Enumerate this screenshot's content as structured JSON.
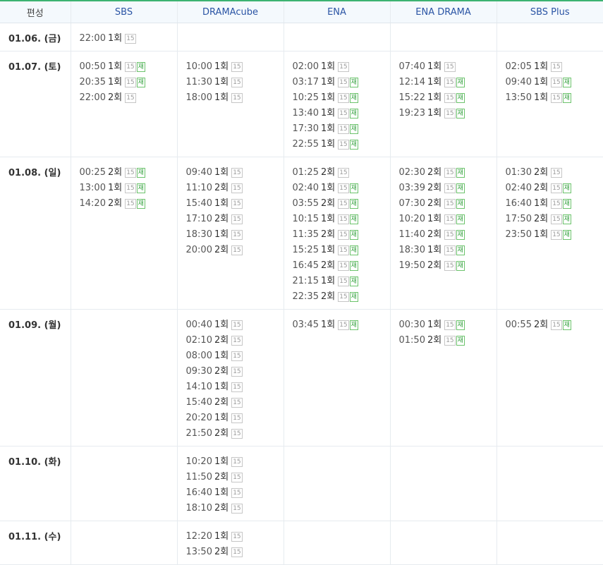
{
  "header": {
    "label": "편성",
    "channels": [
      "SBS",
      "DRAMAcube",
      "ENA",
      "ENA DRAMA",
      "SBS Plus"
    ]
  },
  "rows": [
    {
      "date": "01.06. (금)",
      "height": 36,
      "cells": [
        [
          {
            "time": "22:00",
            "ep": "1회",
            "rating": "15",
            "re": ""
          }
        ],
        [],
        [],
        [],
        []
      ]
    },
    {
      "date": "01.07. (토)",
      "height": 146,
      "cells": [
        [
          {
            "time": "00:50",
            "ep": "1회",
            "rating": "15",
            "re": "재"
          },
          {
            "time": "20:35",
            "ep": "1회",
            "rating": "15",
            "re": "재"
          },
          {
            "time": "22:00",
            "ep": "2회",
            "rating": "15",
            "re": ""
          }
        ],
        [
          {
            "time": "10:00",
            "ep": "1회",
            "rating": "15",
            "re": ""
          },
          {
            "time": "11:30",
            "ep": "1회",
            "rating": "15",
            "re": ""
          },
          {
            "time": "18:00",
            "ep": "1회",
            "rating": "15",
            "re": ""
          }
        ],
        [
          {
            "time": "02:00",
            "ep": "1회",
            "rating": "15",
            "re": ""
          },
          {
            "time": "03:17",
            "ep": "1회",
            "rating": "15",
            "re": "재"
          },
          {
            "time": "10:25",
            "ep": "1회",
            "rating": "15",
            "re": "재"
          },
          {
            "time": "13:40",
            "ep": "1회",
            "rating": "15",
            "re": "재"
          },
          {
            "time": "17:30",
            "ep": "1회",
            "rating": "15",
            "re": "재"
          },
          {
            "time": "22:55",
            "ep": "1회",
            "rating": "15",
            "re": "재"
          }
        ],
        [
          {
            "time": "07:40",
            "ep": "1회",
            "rating": "15",
            "re": ""
          },
          {
            "time": "12:14",
            "ep": "1회",
            "rating": "15",
            "re": "재"
          },
          {
            "time": "15:22",
            "ep": "1회",
            "rating": "15",
            "re": "재"
          },
          {
            "time": "19:23",
            "ep": "1회",
            "rating": "15",
            "re": "재"
          }
        ],
        [
          {
            "time": "02:05",
            "ep": "1회",
            "rating": "15",
            "re": ""
          },
          {
            "time": "09:40",
            "ep": "1회",
            "rating": "15",
            "re": "재"
          },
          {
            "time": "13:50",
            "ep": "1회",
            "rating": "15",
            "re": "재"
          }
        ]
      ]
    },
    {
      "date": "01.08. (일)",
      "height": 212,
      "cells": [
        [
          {
            "time": "00:25",
            "ep": "2회",
            "rating": "15",
            "re": "재"
          },
          {
            "time": "13:00",
            "ep": "1회",
            "rating": "15",
            "re": "재"
          },
          {
            "time": "14:20",
            "ep": "2회",
            "rating": "15",
            "re": "재"
          }
        ],
        [
          {
            "time": "09:40",
            "ep": "1회",
            "rating": "15",
            "re": ""
          },
          {
            "time": "11:10",
            "ep": "2회",
            "rating": "15",
            "re": ""
          },
          {
            "time": "15:40",
            "ep": "1회",
            "rating": "15",
            "re": ""
          },
          {
            "time": "17:10",
            "ep": "2회",
            "rating": "15",
            "re": ""
          },
          {
            "time": "18:30",
            "ep": "1회",
            "rating": "15",
            "re": ""
          },
          {
            "time": "20:00",
            "ep": "2회",
            "rating": "15",
            "re": ""
          }
        ],
        [
          {
            "time": "01:25",
            "ep": "2회",
            "rating": "15",
            "re": ""
          },
          {
            "time": "02:40",
            "ep": "1회",
            "rating": "15",
            "re": "재"
          },
          {
            "time": "03:55",
            "ep": "2회",
            "rating": "15",
            "re": "재"
          },
          {
            "time": "10:15",
            "ep": "1회",
            "rating": "15",
            "re": "재"
          },
          {
            "time": "11:35",
            "ep": "2회",
            "rating": "15",
            "re": "재"
          },
          {
            "time": "15:25",
            "ep": "1회",
            "rating": "15",
            "re": "재"
          },
          {
            "time": "16:45",
            "ep": "2회",
            "rating": "15",
            "re": "재"
          },
          {
            "time": "21:15",
            "ep": "1회",
            "rating": "15",
            "re": "재"
          },
          {
            "time": "22:35",
            "ep": "2회",
            "rating": "15",
            "re": "재"
          }
        ],
        [
          {
            "time": "02:30",
            "ep": "2회",
            "rating": "15",
            "re": "재"
          },
          {
            "time": "03:39",
            "ep": "2회",
            "rating": "15",
            "re": "재"
          },
          {
            "time": "07:30",
            "ep": "2회",
            "rating": "15",
            "re": "재"
          },
          {
            "time": "10:20",
            "ep": "1회",
            "rating": "15",
            "re": "재"
          },
          {
            "time": "11:40",
            "ep": "2회",
            "rating": "15",
            "re": "재"
          },
          {
            "time": "18:30",
            "ep": "1회",
            "rating": "15",
            "re": "재"
          },
          {
            "time": "19:50",
            "ep": "2회",
            "rating": "15",
            "re": "재"
          }
        ],
        [
          {
            "time": "01:30",
            "ep": "2회",
            "rating": "15",
            "re": ""
          },
          {
            "time": "02:40",
            "ep": "2회",
            "rating": "15",
            "re": "재"
          },
          {
            "time": "16:40",
            "ep": "1회",
            "rating": "15",
            "re": "재"
          },
          {
            "time": "17:50",
            "ep": "2회",
            "rating": "15",
            "re": "재"
          },
          {
            "time": "23:50",
            "ep": "1회",
            "rating": "15",
            "re": "재"
          }
        ]
      ]
    },
    {
      "date": "01.09. (월)",
      "height": 190,
      "cells": [
        [],
        [
          {
            "time": "00:40",
            "ep": "1회",
            "rating": "15",
            "re": ""
          },
          {
            "time": "02:10",
            "ep": "2회",
            "rating": "15",
            "re": ""
          },
          {
            "time": "08:00",
            "ep": "1회",
            "rating": "15",
            "re": ""
          },
          {
            "time": "09:30",
            "ep": "2회",
            "rating": "15",
            "re": ""
          },
          {
            "time": "14:10",
            "ep": "1회",
            "rating": "15",
            "re": ""
          },
          {
            "time": "15:40",
            "ep": "2회",
            "rating": "15",
            "re": ""
          },
          {
            "time": "20:20",
            "ep": "1회",
            "rating": "15",
            "re": ""
          },
          {
            "time": "21:50",
            "ep": "2회",
            "rating": "15",
            "re": ""
          }
        ],
        [
          {
            "time": "03:45",
            "ep": "1회",
            "rating": "15",
            "re": "재"
          }
        ],
        [
          {
            "time": "00:30",
            "ep": "1회",
            "rating": "15",
            "re": "재"
          },
          {
            "time": "01:50",
            "ep": "2회",
            "rating": "15",
            "re": "재"
          }
        ],
        [
          {
            "time": "00:55",
            "ep": "2회",
            "rating": "15",
            "re": "재"
          }
        ]
      ]
    },
    {
      "date": "01.10. (화)",
      "height": 102,
      "cells": [
        [],
        [
          {
            "time": "10:20",
            "ep": "1회",
            "rating": "15",
            "re": ""
          },
          {
            "time": "11:50",
            "ep": "2회",
            "rating": "15",
            "re": ""
          },
          {
            "time": "16:40",
            "ep": "1회",
            "rating": "15",
            "re": ""
          },
          {
            "time": "18:10",
            "ep": "2회",
            "rating": "15",
            "re": ""
          }
        ],
        [],
        [],
        []
      ]
    },
    {
      "date": "01.11. (수)",
      "height": 60,
      "cells": [
        [],
        [
          {
            "time": "12:20",
            "ep": "1회",
            "rating": "15",
            "re": ""
          },
          {
            "time": "13:50",
            "ep": "2회",
            "rating": "15",
            "re": ""
          }
        ],
        [],
        [],
        []
      ]
    }
  ]
}
